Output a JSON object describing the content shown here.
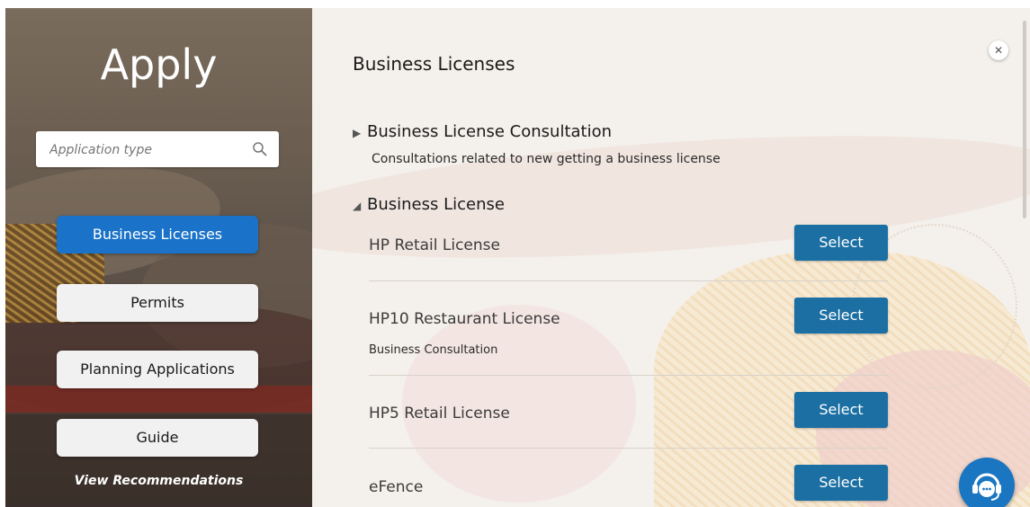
{
  "sidebar": {
    "title": "Apply",
    "search_placeholder": "Application type",
    "nav": [
      {
        "label": "Business Licenses",
        "active": true
      },
      {
        "label": "Permits",
        "active": false
      },
      {
        "label": "Planning Applications",
        "active": false
      },
      {
        "label": "Guide",
        "active": false
      }
    ],
    "view_recommendations": "View Recommendations"
  },
  "main": {
    "title": "Business Licenses",
    "close_icon": "close-icon",
    "groups": [
      {
        "name": "Business License Consultation",
        "expanded": false,
        "description": "Consultations related to new getting a business license"
      },
      {
        "name": "Business License",
        "expanded": true,
        "items": [
          {
            "title": "HP Retail License",
            "subtitle": "",
            "button": "Select"
          },
          {
            "title": "HP10 Restaurant License",
            "subtitle": "Business Consultation",
            "button": "Select"
          },
          {
            "title": "HP5 Retail License",
            "subtitle": "",
            "button": "Select"
          },
          {
            "title": "eFence",
            "subtitle": "",
            "button": "Select"
          }
        ]
      }
    ]
  },
  "colors": {
    "accent": "#1a73c9",
    "select_button": "#1b6fa3",
    "chat_button": "#1a76c0"
  },
  "chat_icon": "headset-chat-icon"
}
